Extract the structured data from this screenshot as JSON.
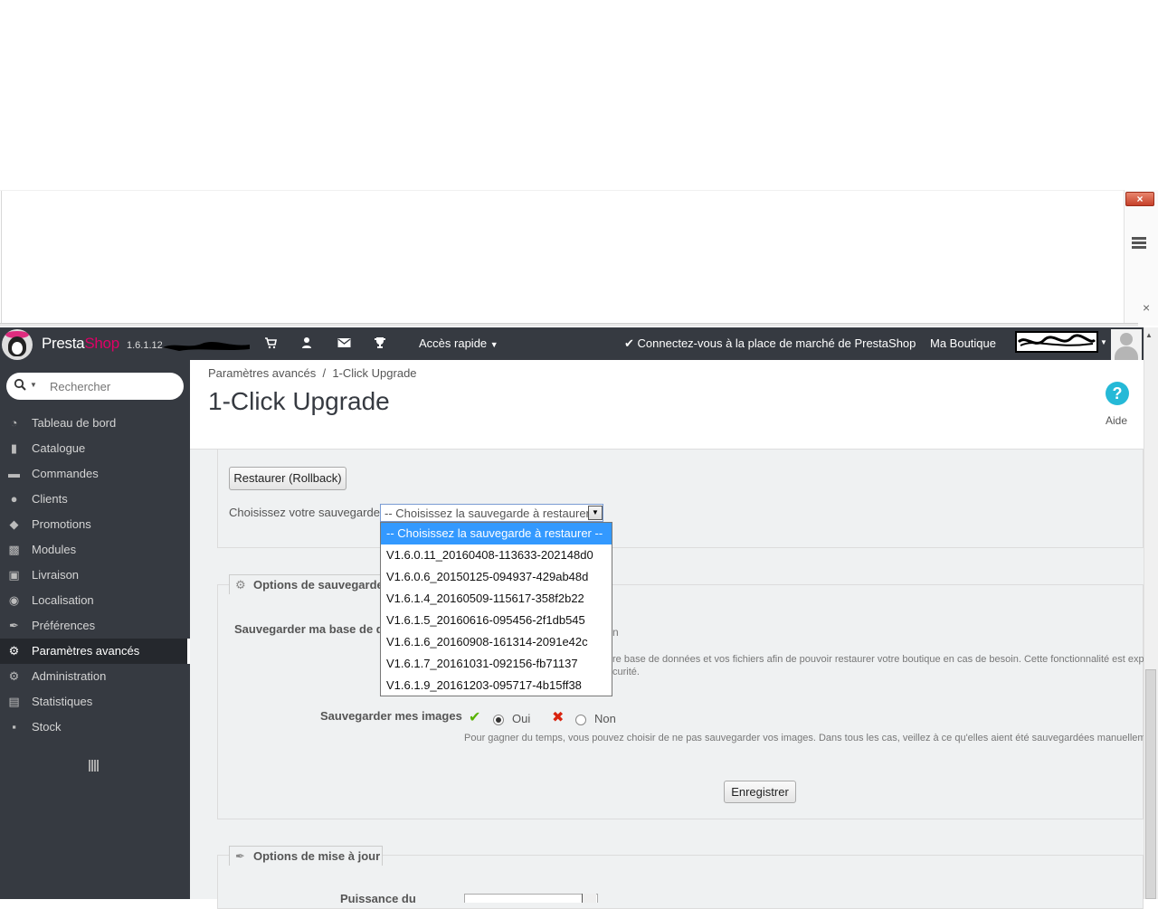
{
  "window": {
    "close_label": "×",
    "menu_icon": "hamburger-icon",
    "close_small_label": "×"
  },
  "topbar": {
    "brand_presta": "Presta",
    "brand_shop": "Shop",
    "version": "1.6.1.12",
    "icons": [
      "cart-icon",
      "user-icon",
      "envelope-icon",
      "trophy-icon"
    ],
    "quick_access": "Accès rapide",
    "marketplace": "Connectez-vous à la place de marché de PrestaShop",
    "my_shop": "Ma Boutique"
  },
  "sidebar": {
    "search_placeholder": "Rechercher",
    "items": [
      {
        "label": "Tableau de bord",
        "icon": "dashboard-icon"
      },
      {
        "label": "Catalogue",
        "icon": "book-icon"
      },
      {
        "label": "Commandes",
        "icon": "credit-card-icon"
      },
      {
        "label": "Clients",
        "icon": "users-icon"
      },
      {
        "label": "Promotions",
        "icon": "tags-icon"
      },
      {
        "label": "Modules",
        "icon": "puzzle-icon"
      },
      {
        "label": "Livraison",
        "icon": "truck-icon"
      },
      {
        "label": "Localisation",
        "icon": "globe-icon"
      },
      {
        "label": "Préférences",
        "icon": "wrench-icon"
      },
      {
        "label": "Paramètres avancés",
        "icon": "cogs-icon",
        "active": true
      },
      {
        "label": "Administration",
        "icon": "cog-icon"
      },
      {
        "label": "Statistiques",
        "icon": "bar-chart-icon"
      },
      {
        "label": "Stock",
        "icon": "archive-icon"
      }
    ]
  },
  "page": {
    "breadcrumb_parent": "Paramètres avancés",
    "breadcrumb_sep": "/",
    "breadcrumb_current": "1-Click Upgrade",
    "title": "1-Click Upgrade",
    "help_symbol": "?",
    "help_label": "Aide"
  },
  "rollback": {
    "button": "Restaurer (Rollback)",
    "choose_label": "Choisissez votre sauvegarde :",
    "selected": "-- Choisissez la sauvegarde à restaurer --",
    "options": [
      "-- Choisissez la sauvegarde à restaurer --",
      "V1.6.0.11_20160408-113633-202148d0",
      "V1.6.0.6_20150125-094937-429ab48d",
      "V1.6.1.4_20160509-115617-358f2b22",
      "V1.6.1.5_20160616-095456-2f1db545",
      "V1.6.1.6_20160908-161314-2091e42c",
      "V1.6.1.7_20161031-092156-fb71137",
      "V1.6.1.9_20161203-095717-4b15ff38"
    ]
  },
  "backup_options": {
    "legend": "Options de sauvegarde",
    "db_label": "Sauvegarder ma base de do",
    "db_tail": "n",
    "db_help_line1": "re base de données et vos fichiers afin de pouvoir restaurer votre boutique en cas de besoin. Cette fonctionnalité est expéri",
    "db_help_line2": "curité.",
    "images_label": "Sauvegarder mes images",
    "yes": "Oui",
    "no": "Non",
    "images_selected": "Oui",
    "images_help": "Pour gagner du temps, vous pouvez choisir de ne pas sauvegarder vos images. Dans tous les cas, veillez à ce qu'elles aient été sauvegardées manuellement.",
    "save_button": "Enregistrer"
  },
  "upgrade_options": {
    "legend": "Options de mise à jour",
    "partial_label": "Puissance du"
  }
}
